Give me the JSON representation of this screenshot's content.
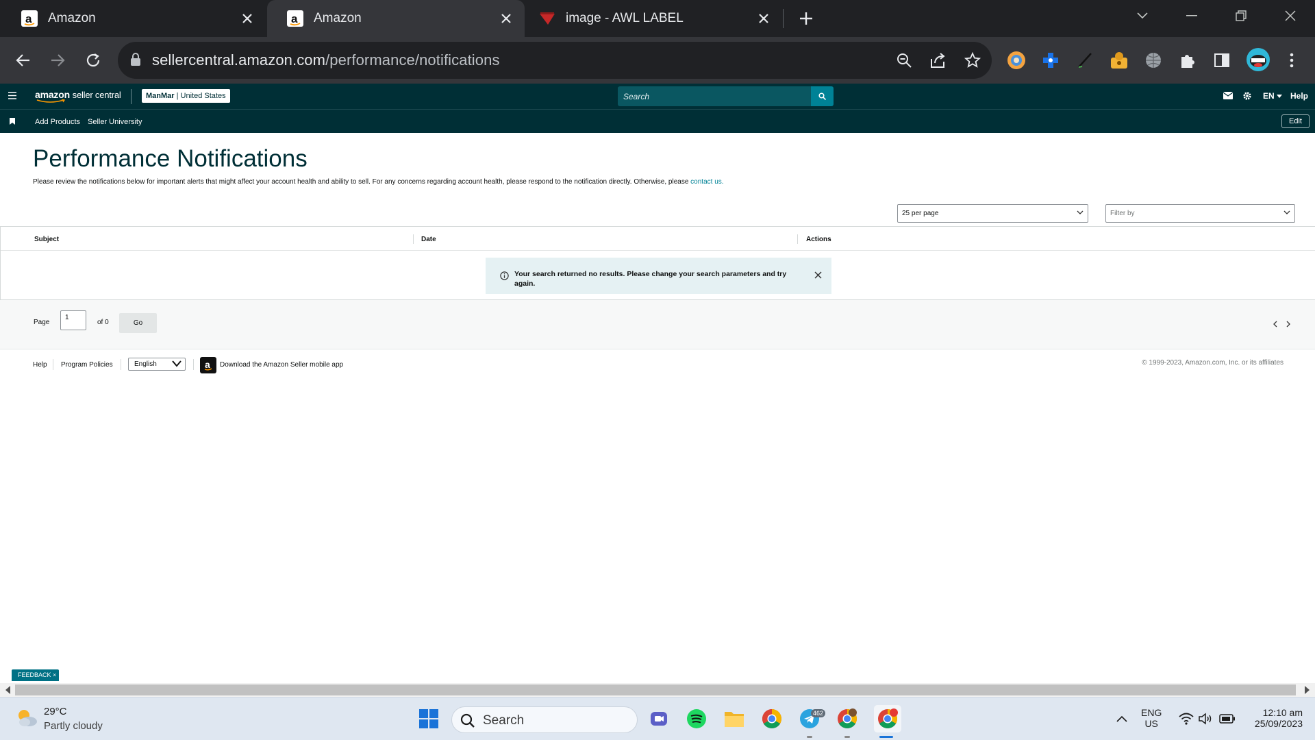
{
  "browser": {
    "tabs": [
      {
        "title": "Amazon",
        "icon": "amazon-icon",
        "active": false
      },
      {
        "title": "Amazon",
        "icon": "amazon-icon",
        "active": true
      },
      {
        "title": "image - AWL LABEL",
        "icon": "awl-label-icon",
        "active": false
      }
    ],
    "url_host": "sellercentral.amazon.com",
    "url_path": "/performance/notifications"
  },
  "header": {
    "logo_brand": "amazon",
    "logo_sub": "seller central",
    "account_store": "ManMar",
    "account_region": "United States",
    "search_placeholder": "Search",
    "lang": "EN",
    "help": "Help"
  },
  "subnav": {
    "links": [
      "Add Products",
      "Seller University"
    ],
    "edit": "Edit"
  },
  "page": {
    "title": "Performance Notifications",
    "description": "Please review the notifications below for important alerts that might affect your account health and ability to sell. For any concerns regarding account health, please respond to the notification directly. Otherwise, please",
    "contact_link": "contact us."
  },
  "controls": {
    "per_page": "25 per page",
    "filter_placeholder": "Filter by"
  },
  "table": {
    "columns": [
      "Subject",
      "Date",
      "Actions"
    ],
    "empty_message": "Your search returned no results. Please change your search parameters and try again."
  },
  "pager": {
    "page_label": "Page",
    "current_page": "1",
    "of_label": "of 0",
    "go_label": "Go"
  },
  "footer": {
    "help": "Help",
    "program_policies": "Program Policies",
    "language": "English",
    "app_download": "Download the Amazon Seller mobile app",
    "copyright": "© 1999-2023, Amazon.com, Inc. or its affiliates"
  },
  "feedback": "FEEDBACK ×",
  "taskbar": {
    "temperature": "29°C",
    "condition": "Partly cloudy",
    "search": "Search",
    "telegram_badge": "462",
    "lang_line1": "ENG",
    "lang_line2": "US",
    "time": "12:10 am",
    "date": "25/09/2023"
  },
  "colors": {
    "header_bg": "#002f36",
    "accent_teal": "#008296",
    "alert_bg": "#e5f1f3"
  }
}
